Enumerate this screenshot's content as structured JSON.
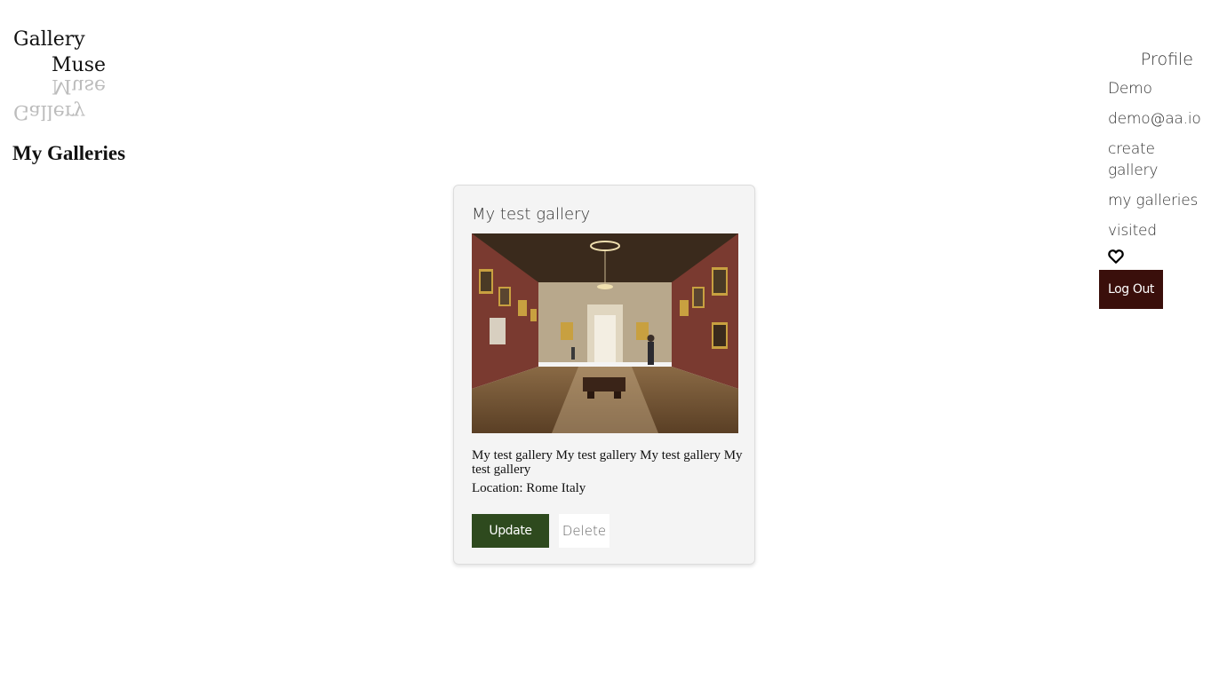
{
  "logo": {
    "line1": "Gallery",
    "line2": "Muse"
  },
  "page": {
    "title": "My Galleries"
  },
  "nav": {
    "profile_heading": "Profile",
    "username": "Demo",
    "email": "demo@aa.io",
    "create_gallery": "create gallery",
    "my_galleries": "my galleries",
    "visited": "visited",
    "heart_icon": "heart-outline-icon",
    "logout_label": "Log Out"
  },
  "gallery_card": {
    "title": "My test gallery",
    "image_subject": "museum-gallery-interior-photo",
    "description": "My test gallery My test gallery My test gallery My test gallery",
    "location": "Location: Rome Italy",
    "update_label": "Update",
    "delete_label": "Delete"
  },
  "colors": {
    "logout_bg": "#3a0f0b",
    "update_bg": "#2e4a1e",
    "card_bg": "#f4f4f4"
  }
}
